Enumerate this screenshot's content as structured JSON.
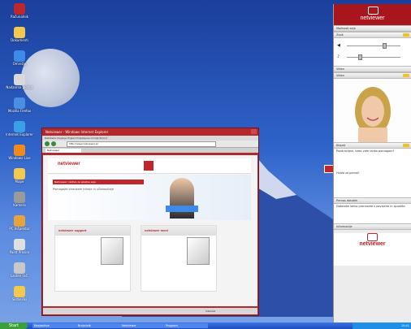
{
  "desktop": {
    "icons": [
      {
        "label": "Računalnik",
        "color": "#c0272d"
      },
      {
        "label": "Dokumenti",
        "color": "#f2c94c"
      },
      {
        "label": "Omrežje",
        "color": "#3d8be8"
      },
      {
        "label": "Nadzorna plošča",
        "color": "#d9d9d9"
      },
      {
        "label": "Mozilla Firefox",
        "color": "#4b8fe3"
      },
      {
        "label": "Internet Explorer",
        "color": "#3aa0e8"
      },
      {
        "label": "Windows Live",
        "color": "#f08a1c"
      },
      {
        "label": "Mape",
        "color": "#f2c94c"
      },
      {
        "label": "Kamera",
        "color": "#9a9a9a"
      },
      {
        "label": "PC Inšpektor",
        "color": "#e8a33a"
      },
      {
        "label": "Paint Prosim",
        "color": "#e0e0e0"
      },
      {
        "label": "Lasten rač.",
        "color": "#c8c8c8"
      },
      {
        "label": "Skrbniški",
        "color": "#f2c94c"
      }
    ]
  },
  "taskbar": {
    "start_label": "Start",
    "tasks": [
      "Nastavitve",
      "Brskalnik",
      "Netviewer",
      "Program"
    ],
    "clock": "10:41"
  },
  "browser": {
    "title": "Netviewer - Windows Internet Explorer",
    "menu": "Datoteka  Urejanje  Pogled  Priljubljene  Orodja  Pomoč",
    "address": "http://www.netviewer.si/",
    "tab": "Netviewer",
    "status": "Internet"
  },
  "website": {
    "logo": "netviewer",
    "redbar": "Netviewer: rešitve za spletne seje",
    "headline": "Pomagajte strankam hitreje in učinkoviteje",
    "products": [
      {
        "name": "netviewer support"
      },
      {
        "name": "netviewer meet"
      }
    ]
  },
  "panel": {
    "logo": "netviewer",
    "sections": {
      "session": "Možnosti seje",
      "audio": "Zvok",
      "video": "Video",
      "chat": "Klepet",
      "file": "Prenos datotek",
      "info": "Informacije"
    },
    "chat_lines": [
      "Pozdravljeni, kako vam lahko pomagam?",
      "Hvala za pomoč."
    ],
    "file_text": "Datoteke lahko prenesete s povlecite in spustite.",
    "footer_logo": "netviewer"
  }
}
